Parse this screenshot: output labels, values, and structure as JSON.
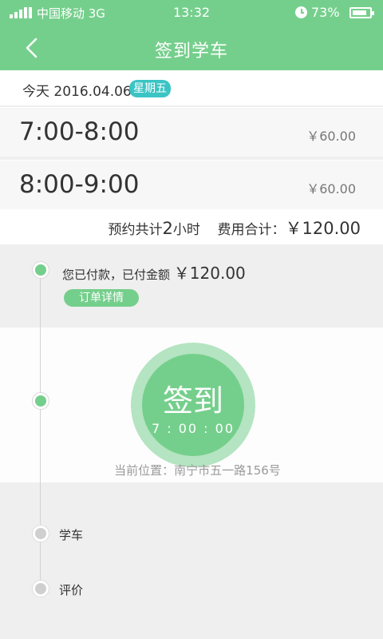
{
  "status_bar": {
    "carrier": "中国移动 3G",
    "time": "13:32",
    "battery": "73%"
  },
  "nav": {
    "title": "签到学车",
    "back_icon": "chevron-left-icon"
  },
  "date": {
    "text": "今天 2016.04.06",
    "weekday": "星期五",
    "weekday_color": "#3cc4c4"
  },
  "slots": [
    {
      "range": "7:00-8:00",
      "price": "￥60.00"
    },
    {
      "range": "8:00-9:00",
      "price": "￥60.00"
    }
  ],
  "summary": {
    "prefix": "预约共计",
    "hours": "2",
    "suffix": "小时",
    "fee_label": "费用合计：",
    "total": "￥120.00"
  },
  "timeline": {
    "paid_text": "您已付款，已付金额",
    "paid_amount": "￥120.00",
    "order_button": "订单详情",
    "checkin_label": "签到",
    "checkin_time": "7 : 00 : 00",
    "location": "当前位置：南宁市五一路156号",
    "step_learn": "学车",
    "step_review": "评价"
  },
  "colors": {
    "accent": "#75cf8c",
    "accent_light": "#b4e4c1"
  }
}
